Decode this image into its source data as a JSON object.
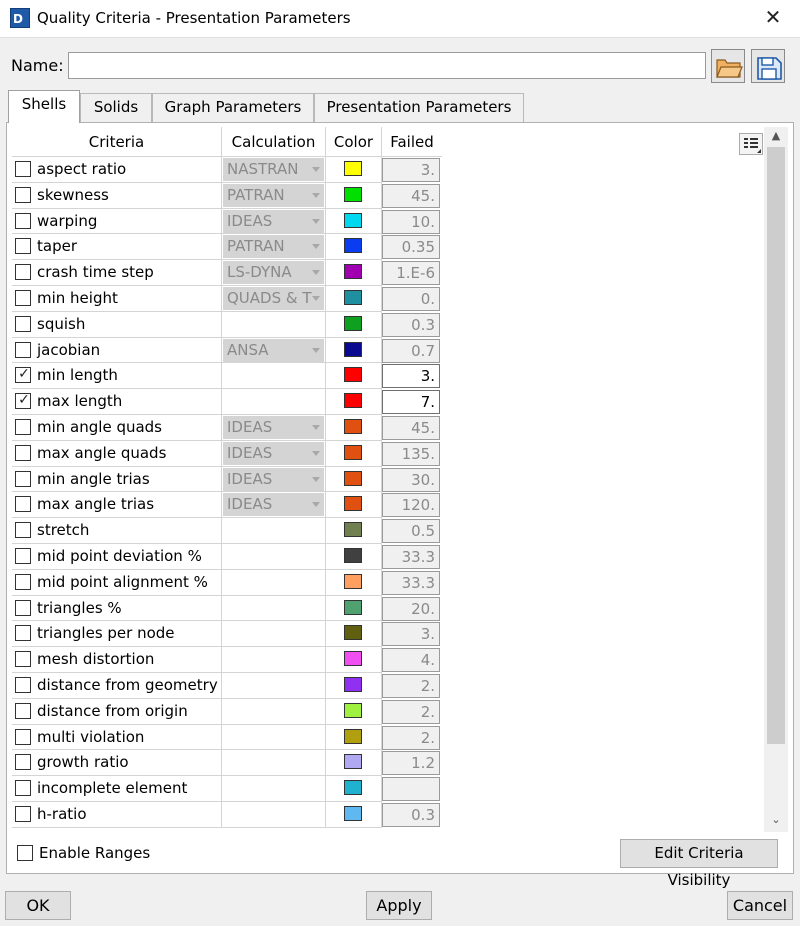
{
  "window": {
    "title": "Quality Criteria - Presentation Parameters",
    "close_label": "✕"
  },
  "name": {
    "label": "Name:",
    "value": ""
  },
  "tabs": [
    {
      "label": "Shells",
      "active": true
    },
    {
      "label": "Solids",
      "active": false
    },
    {
      "label": "Graph Parameters",
      "active": false
    },
    {
      "label": "Presentation Parameters",
      "active": false
    }
  ],
  "table": {
    "headers": {
      "criteria": "Criteria",
      "calculation": "Calculation",
      "color": "Color",
      "failed": "Failed"
    },
    "rows": [
      {
        "criteria": "aspect ratio",
        "checked": false,
        "calculation": "NASTRAN",
        "calc_dropdown": true,
        "color": "#ffff00",
        "failed": "3."
      },
      {
        "criteria": "skewness",
        "checked": false,
        "calculation": "PATRAN",
        "calc_dropdown": true,
        "color": "#00e000",
        "failed": "45."
      },
      {
        "criteria": "warping",
        "checked": false,
        "calculation": "IDEAS",
        "calc_dropdown": true,
        "color": "#00d8f0",
        "failed": "10."
      },
      {
        "criteria": "taper",
        "checked": false,
        "calculation": "PATRAN",
        "calc_dropdown": true,
        "color": "#0a3cf0",
        "failed": "0.35"
      },
      {
        "criteria": "crash time step",
        "checked": false,
        "calculation": "LS-DYNA",
        "calc_dropdown": true,
        "color": "#a000b0",
        "failed": "1.E-6"
      },
      {
        "criteria": "min height",
        "checked": false,
        "calculation": "QUADS & T",
        "calc_dropdown": true,
        "color": "#2090a0",
        "failed": "0."
      },
      {
        "criteria": "squish",
        "checked": false,
        "calculation": "",
        "calc_dropdown": false,
        "color": "#10a020",
        "failed": "0.3"
      },
      {
        "criteria": "jacobian",
        "checked": false,
        "calculation": "ANSA",
        "calc_dropdown": true,
        "color": "#0a0a90",
        "failed": "0.7"
      },
      {
        "criteria": "min length",
        "checked": true,
        "calculation": "",
        "calc_dropdown": false,
        "color": "#ff0000",
        "failed": "3."
      },
      {
        "criteria": "max length",
        "checked": true,
        "calculation": "",
        "calc_dropdown": false,
        "color": "#ff0000",
        "failed": "7."
      },
      {
        "criteria": "min angle quads",
        "checked": false,
        "calculation": "IDEAS",
        "calc_dropdown": true,
        "color": "#e05010",
        "failed": "45."
      },
      {
        "criteria": "max angle quads",
        "checked": false,
        "calculation": "IDEAS",
        "calc_dropdown": true,
        "color": "#e05010",
        "failed": "135."
      },
      {
        "criteria": "min angle trias",
        "checked": false,
        "calculation": "IDEAS",
        "calc_dropdown": true,
        "color": "#e05010",
        "failed": "30."
      },
      {
        "criteria": "max angle trias",
        "checked": false,
        "calculation": "IDEAS",
        "calc_dropdown": true,
        "color": "#e05010",
        "failed": "120."
      },
      {
        "criteria": "stretch",
        "checked": false,
        "calculation": "",
        "calc_dropdown": false,
        "color": "#708050",
        "failed": "0.5"
      },
      {
        "criteria": "mid point deviation %",
        "checked": false,
        "calculation": "",
        "calc_dropdown": false,
        "color": "#404040",
        "failed": "33.3"
      },
      {
        "criteria": "mid point alignment %",
        "checked": false,
        "calculation": "",
        "calc_dropdown": false,
        "color": "#ffa060",
        "failed": "33.3"
      },
      {
        "criteria": "triangles %",
        "checked": false,
        "calculation": "",
        "calc_dropdown": false,
        "color": "#50a070",
        "failed": "20."
      },
      {
        "criteria": "triangles per node",
        "checked": false,
        "calculation": "",
        "calc_dropdown": false,
        "color": "#606010",
        "failed": "3."
      },
      {
        "criteria": "mesh distortion",
        "checked": false,
        "calculation": "",
        "calc_dropdown": false,
        "color": "#f050f0",
        "failed": "4."
      },
      {
        "criteria": "distance from geometry",
        "checked": false,
        "calculation": "",
        "calc_dropdown": false,
        "color": "#9030f0",
        "failed": "2."
      },
      {
        "criteria": "distance from origin",
        "checked": false,
        "calculation": "",
        "calc_dropdown": false,
        "color": "#a0f040",
        "failed": "2."
      },
      {
        "criteria": "multi violation",
        "checked": false,
        "calculation": "",
        "calc_dropdown": false,
        "color": "#b0a010",
        "failed": "2."
      },
      {
        "criteria": "growth ratio",
        "checked": false,
        "calculation": "",
        "calc_dropdown": false,
        "color": "#b0a8f0",
        "failed": "1.2"
      },
      {
        "criteria": "incomplete element",
        "checked": false,
        "calculation": "",
        "calc_dropdown": false,
        "color": "#20b0d0",
        "failed": ""
      },
      {
        "criteria": "h-ratio",
        "checked": false,
        "calculation": "",
        "calc_dropdown": false,
        "color": "#60b8f0",
        "failed": "0.3"
      }
    ]
  },
  "enable_ranges": {
    "label": "Enable Ranges",
    "checked": false
  },
  "buttons": {
    "edit_visibility": "Edit Criteria Visibility",
    "ok": "OK",
    "apply": "Apply",
    "cancel": "Cancel"
  },
  "icons": {
    "app": "app-logo-icon",
    "open": "open-folder-icon",
    "save": "save-disk-icon",
    "options": "column-options-icon"
  }
}
